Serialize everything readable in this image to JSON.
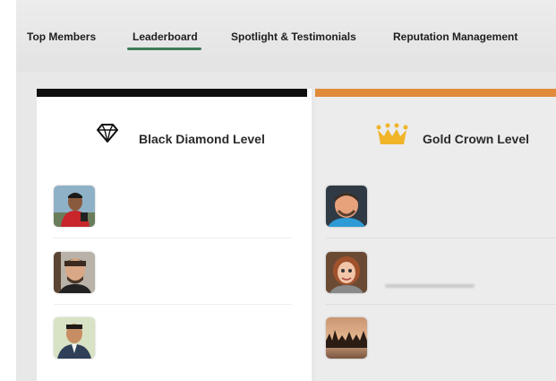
{
  "nav": {
    "tabs": [
      {
        "label": "Top Members"
      },
      {
        "label": "Leaderboard"
      },
      {
        "label": "Spotlight & Testimonials"
      },
      {
        "label": "Reputation Management"
      }
    ],
    "active_tab": "Leaderboard"
  },
  "levels": {
    "black_diamond": {
      "title": "Black Diamond Level",
      "icon": "diamond-icon",
      "accent_color": "#0f0f0f",
      "members": [
        {
          "avatar": "member-photo"
        },
        {
          "avatar": "member-photo"
        },
        {
          "avatar": "member-photo"
        }
      ]
    },
    "gold_crown": {
      "title": "Gold Crown Level",
      "icon": "crown-icon",
      "accent_color": "#e08a3a",
      "members": [
        {
          "avatar": "member-photo"
        },
        {
          "avatar": "member-photo"
        },
        {
          "avatar": "member-photo"
        }
      ]
    }
  }
}
